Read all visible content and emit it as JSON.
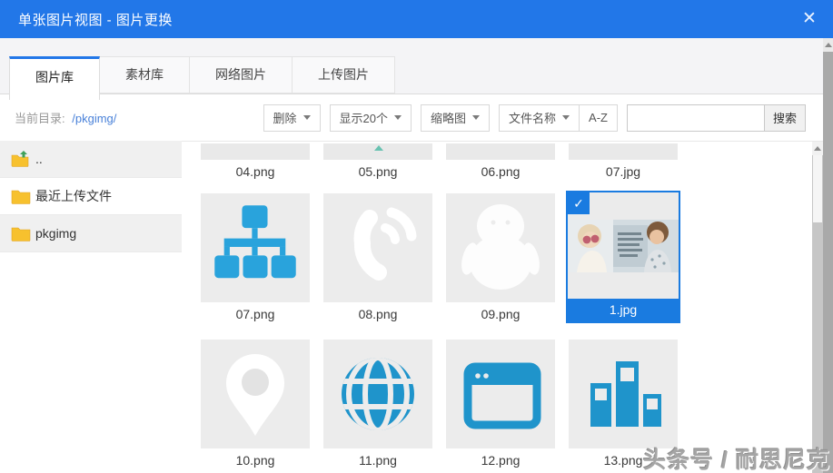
{
  "dialog": {
    "title": "单张图片视图 - 图片更换"
  },
  "icons": {
    "close": "✕",
    "check": "✓"
  },
  "tabs": [
    {
      "label": "图片库",
      "active": true
    },
    {
      "label": "素材库",
      "active": false
    },
    {
      "label": "网络图片",
      "active": false
    },
    {
      "label": "上传图片",
      "active": false
    }
  ],
  "toolbar": {
    "breadcrumb": {
      "label": "当前目录:",
      "path": "/pkgimg/"
    },
    "delete_label": "删除",
    "show_count_label": "显示20个",
    "view_mode_label": "缩略图",
    "sort_field_label": "文件名称",
    "sort_order_label": "A-Z",
    "search_button_label": "搜索",
    "search_value": "",
    "search_placeholder": ""
  },
  "sidebar": {
    "items": [
      {
        "label": "..",
        "icon": "folder-up-icon"
      },
      {
        "label": "最近上传文件",
        "icon": "folder-icon"
      },
      {
        "label": "pkgimg",
        "icon": "folder-icon"
      }
    ]
  },
  "grid": {
    "partial_row": [
      "04.png",
      "05.png",
      "06.png",
      "07.jpg"
    ],
    "rows": [
      [
        {
          "name": "07.png",
          "icon": "org-chart-icon",
          "selected": false
        },
        {
          "name": "08.png",
          "icon": "phone-icon",
          "selected": false
        },
        {
          "name": "09.png",
          "icon": "qq-penguin-icon",
          "selected": false
        },
        {
          "name": "1.jpg",
          "icon": "photo-thumbnail",
          "selected": true
        }
      ],
      [
        {
          "name": "10.png",
          "icon": "map-pin-icon",
          "selected": false
        },
        {
          "name": "11.png",
          "icon": "globe-icon",
          "selected": false
        },
        {
          "name": "12.png",
          "icon": "browser-window-icon",
          "selected": false
        },
        {
          "name": "13.png",
          "icon": "bar-chart-icon",
          "selected": false
        }
      ]
    ],
    "selected_file": "1.jpg"
  },
  "watermark": "头条号 / 耐思尼克",
  "colors": {
    "accent": "#2277e8",
    "icon-blue": "#29a3dc",
    "icon-blue-deep": "#1f94cb",
    "selected-blue": "#1a7be0"
  }
}
